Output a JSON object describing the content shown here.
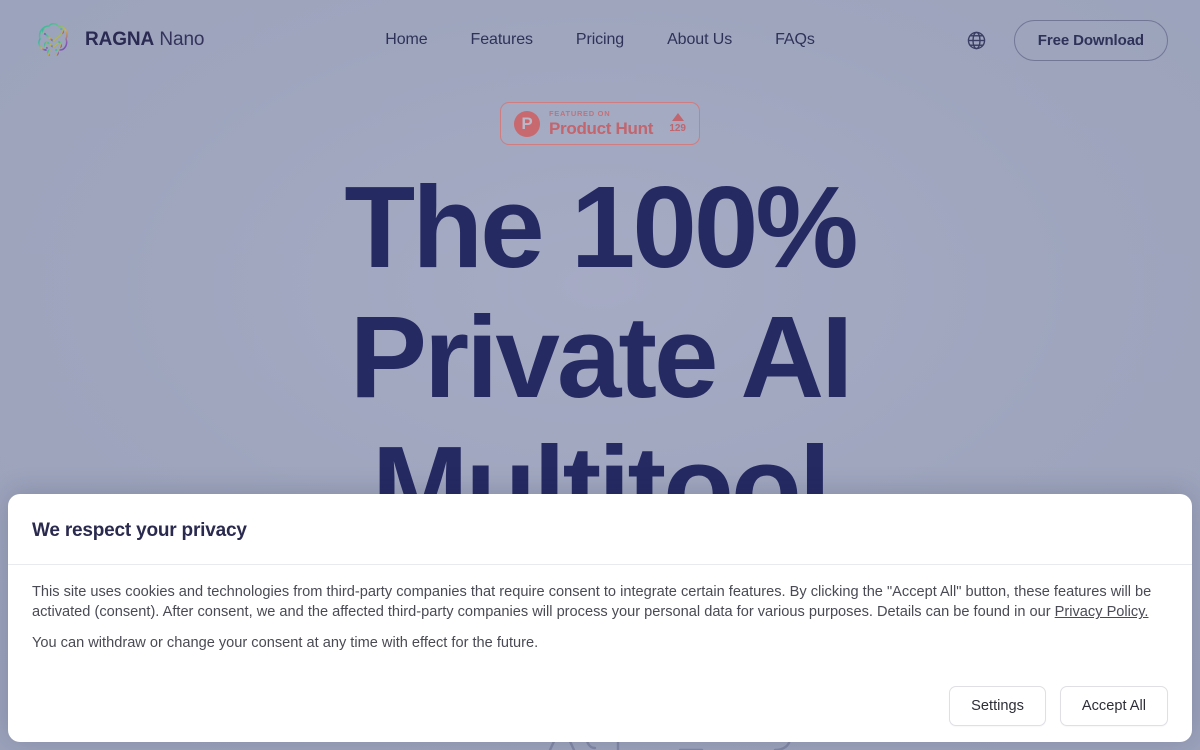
{
  "brand": {
    "name_bold": "RAGNA",
    "name_light": "Nano",
    "logo_icon": "brain-tree-logo"
  },
  "nav": {
    "items": [
      {
        "label": "Home"
      },
      {
        "label": "Features"
      },
      {
        "label": "Pricing"
      },
      {
        "label": "About Us"
      },
      {
        "label": "FAQs"
      }
    ]
  },
  "header_right": {
    "globe_icon": "globe-icon",
    "download_label": "Free Download"
  },
  "hero": {
    "product_hunt": {
      "logo_letter": "P",
      "featured_on": "FEATURED ON",
      "product_name": "Product Hunt",
      "upvote_icon": "triangle-up-icon",
      "upvote_count": "129"
    },
    "title": "The 100% Private AI Multitool"
  },
  "cookie_banner": {
    "title": "We respect your privacy",
    "paragraph_1_before_link": "This site uses cookies and technologies from third-party companies that require consent to integrate certain features. By clicking the \"Accept All\" button, these features will be activated (consent). After consent, we and the affected third-party companies will process your personal data for various purposes. Details can be found in our ",
    "privacy_link": "Privacy Policy.",
    "paragraph_2": "You can withdraw or change your consent at any time with effect for the future.",
    "settings_label": "Settings",
    "accept_label": "Accept All"
  },
  "colors": {
    "page_background": "#9ea5bd",
    "headline": "#252a63",
    "product_hunt_red": "#c1656e",
    "banner_background": "#ffffff",
    "brand_text": "#2a2a52"
  }
}
